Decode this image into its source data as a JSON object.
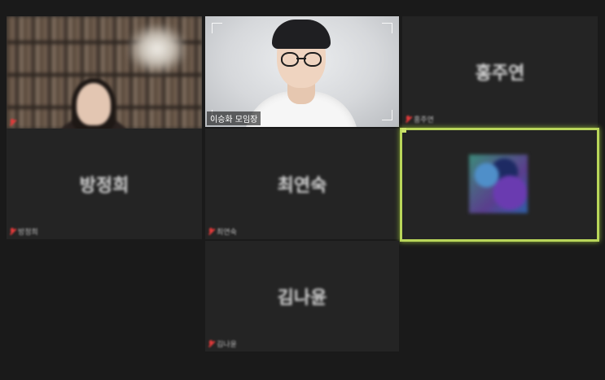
{
  "participants": [
    {
      "id": "p1",
      "name": "",
      "muted": true,
      "video": true
    },
    {
      "id": "p2",
      "name": "이승화 모임장",
      "muted": false,
      "video": true,
      "presenter": true
    },
    {
      "id": "p3",
      "name": "홍주연",
      "muted": true,
      "video": false
    },
    {
      "id": "p4",
      "name": "방정희",
      "muted": true,
      "video": false
    },
    {
      "id": "p5",
      "name": "최연숙",
      "muted": true,
      "video": false
    },
    {
      "id": "p6",
      "name": "",
      "muted": false,
      "video": false,
      "active_speaker": true,
      "avatar": "profile-photo"
    },
    {
      "id": "p7",
      "name": "김나윤",
      "muted": true,
      "video": false
    }
  ],
  "colors": {
    "background": "#1a1a1a",
    "tile": "#242424",
    "active_border": "#b9d65a",
    "muted": "#e03a3a"
  },
  "icons": {
    "mute": "mic-off-icon"
  }
}
